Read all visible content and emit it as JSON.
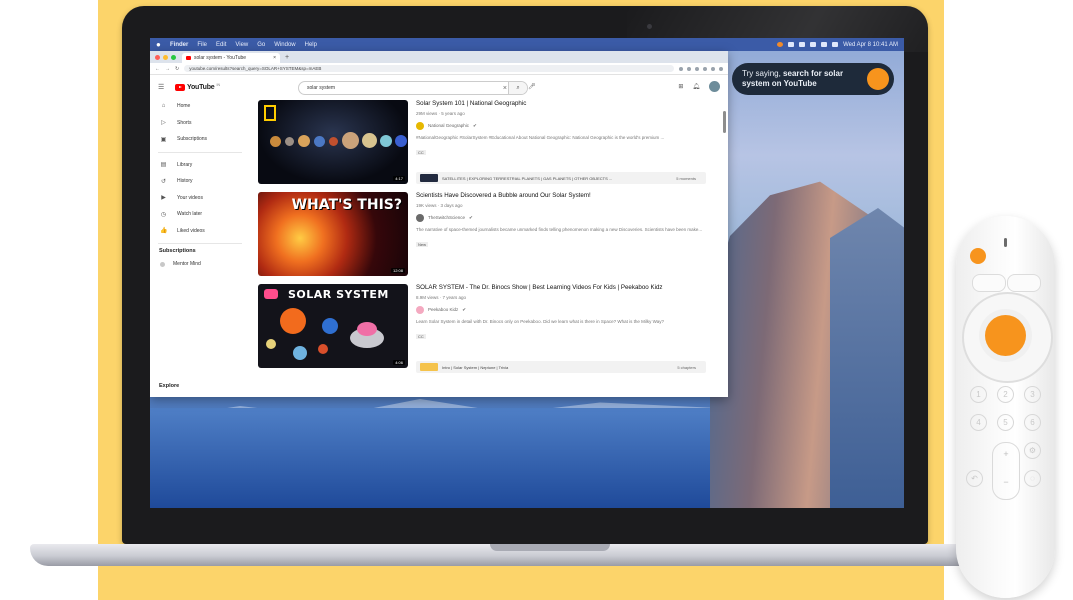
{
  "menubar": {
    "app": "Finder",
    "items": [
      "File",
      "Edit",
      "View",
      "Go",
      "Window",
      "Help"
    ],
    "clock": "Wed Apr 8  10:41 AM"
  },
  "browser": {
    "tab_title": "solar system - YouTube",
    "tab_close": "×",
    "new_tab": "+",
    "url": "youtube.com/results?search_query=SOLAR+SYSTEM&sp=mAEB"
  },
  "youtube": {
    "logo_text": "YouTube",
    "logo_region": "IN",
    "search_value": "solar system",
    "sidebar_main": [
      {
        "label": "Home",
        "icon": "⌂"
      },
      {
        "label": "Shorts",
        "icon": "▷"
      },
      {
        "label": "Subscriptions",
        "icon": "▣"
      }
    ],
    "sidebar_library": [
      {
        "label": "Library",
        "icon": "▤"
      },
      {
        "label": "History",
        "icon": "↺"
      },
      {
        "label": "Your videos",
        "icon": "▶"
      },
      {
        "label": "Watch later",
        "icon": "◷"
      },
      {
        "label": "Liked videos",
        "icon": "👍"
      }
    ],
    "subscriptions_title": "Subscriptions",
    "subscription_channel": "Mentor Mind",
    "explore_title": "Explore",
    "results": [
      {
        "title": "Solar System 101 | National Geographic",
        "meta": "29M views · 5 years ago",
        "channel": "National Geographic",
        "desc": "#NationalGeographic #SolarSystem #Educational About National Geographic: National Geographic is the world's premium ...",
        "badge": "CC",
        "duration": "4:17",
        "chapter_text": "SATELLITES | EXPLORING TERRESTRIAL PLANETS | GAS PLANETS | OTHER OBJECTS ...",
        "chapter_count": "5 moments"
      },
      {
        "title": "Scientists Have Discovered a Bubble around Our Solar System!",
        "meta": "19K views · 3 days ago",
        "channel": "TheSwitchScience",
        "desc": "The narrative of space-themed journalists became unmarked finds telling phenomenon making a new Discoveries. Scientists have been make...",
        "badge": "New",
        "duration": "12:08",
        "thumb_text": "WHAT'S THIS?"
      },
      {
        "title": "SOLAR SYSTEM - The Dr. Binocs Show | Best Learning Videos For Kids | Peekaboo Kidz",
        "meta": "8.9M views · 7 years ago",
        "channel": "Peekaboo Kidz",
        "desc": "Learn Solar System in detail with Dr. Binocs only on Peekaboo. Did we learn what is there in Space? What is the Milky Way?",
        "badge": "CC",
        "duration": "4:06",
        "thumb_text": "SOLAR SYSTEM",
        "chapter_text": "Intro | Solar System | Neptune | Trivia",
        "chapter_count": "5 chapters"
      }
    ]
  },
  "assistant": {
    "prompt_prefix": "Try saying, ",
    "prompt_bold": "search for solar system on YouTube"
  },
  "remote": {
    "keys": [
      "1",
      "2",
      "3",
      "4",
      "5",
      "6"
    ],
    "vol_up": "+",
    "vol_down": "−"
  },
  "colors": {
    "yellow": "#fcd46a",
    "accent_orange": "#f7941d",
    "youtube_red": "#ff0000"
  }
}
